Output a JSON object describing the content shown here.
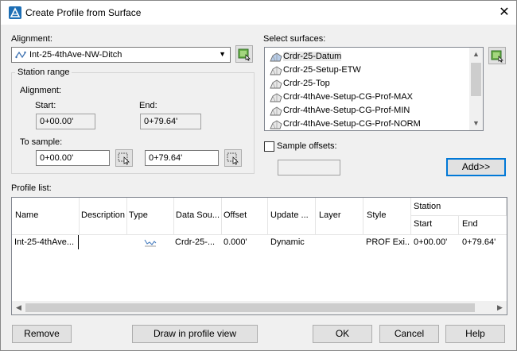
{
  "window": {
    "title": "Create Profile from Surface"
  },
  "alignment": {
    "label": "Alignment:",
    "selected": "Int-25-4thAve-NW-Ditch"
  },
  "station_range": {
    "title": "Station range",
    "alignment_label": "Alignment:",
    "start_label": "Start:",
    "end_label": "End:",
    "start_value": "0+00.00'",
    "end_value": "0+79.64'",
    "to_sample_label": "To sample:",
    "sample_start": "0+00.00'",
    "sample_end": "0+79.64'"
  },
  "surfaces": {
    "label": "Select surfaces:",
    "items": [
      {
        "label": "Crdr-25-Datum",
        "selected": true
      },
      {
        "label": "Crdr-25-Setup-ETW",
        "selected": false
      },
      {
        "label": "Crdr-25-Top",
        "selected": false
      },
      {
        "label": "Crdr-4thAve-Setup-CG-Prof-MAX",
        "selected": false
      },
      {
        "label": "Crdr-4thAve-Setup-CG-Prof-MIN",
        "selected": false
      },
      {
        "label": "Crdr-4thAve-Setup-CG-Prof-NORM",
        "selected": false
      }
    ]
  },
  "sample_offsets": {
    "label": "Sample offsets:",
    "checked": false,
    "value": ""
  },
  "add_button": "Add>>",
  "profile_list": {
    "label": "Profile list:",
    "group_header": "Station",
    "columns": [
      "Name",
      "Description",
      "Type",
      "Data Sou...",
      "Offset",
      "Update ...",
      "Layer",
      "Style",
      "Start",
      "End"
    ],
    "rows": [
      {
        "name": "Int-25-4thAve...",
        "description": "",
        "type_icon": "profile-surface-icon",
        "data_source": "Crdr-25-...",
        "offset": "0.000'",
        "update_mode": "Dynamic",
        "layer": "",
        "style": "PROF Exi...",
        "start": "0+00.00'",
        "end": "0+79.64'"
      }
    ]
  },
  "buttons": {
    "remove": "Remove",
    "draw": "Draw in profile view",
    "ok": "OK",
    "cancel": "Cancel",
    "help": "Help"
  },
  "colors": {
    "accent": "#0078d7",
    "selection": "#e8e8e8"
  }
}
